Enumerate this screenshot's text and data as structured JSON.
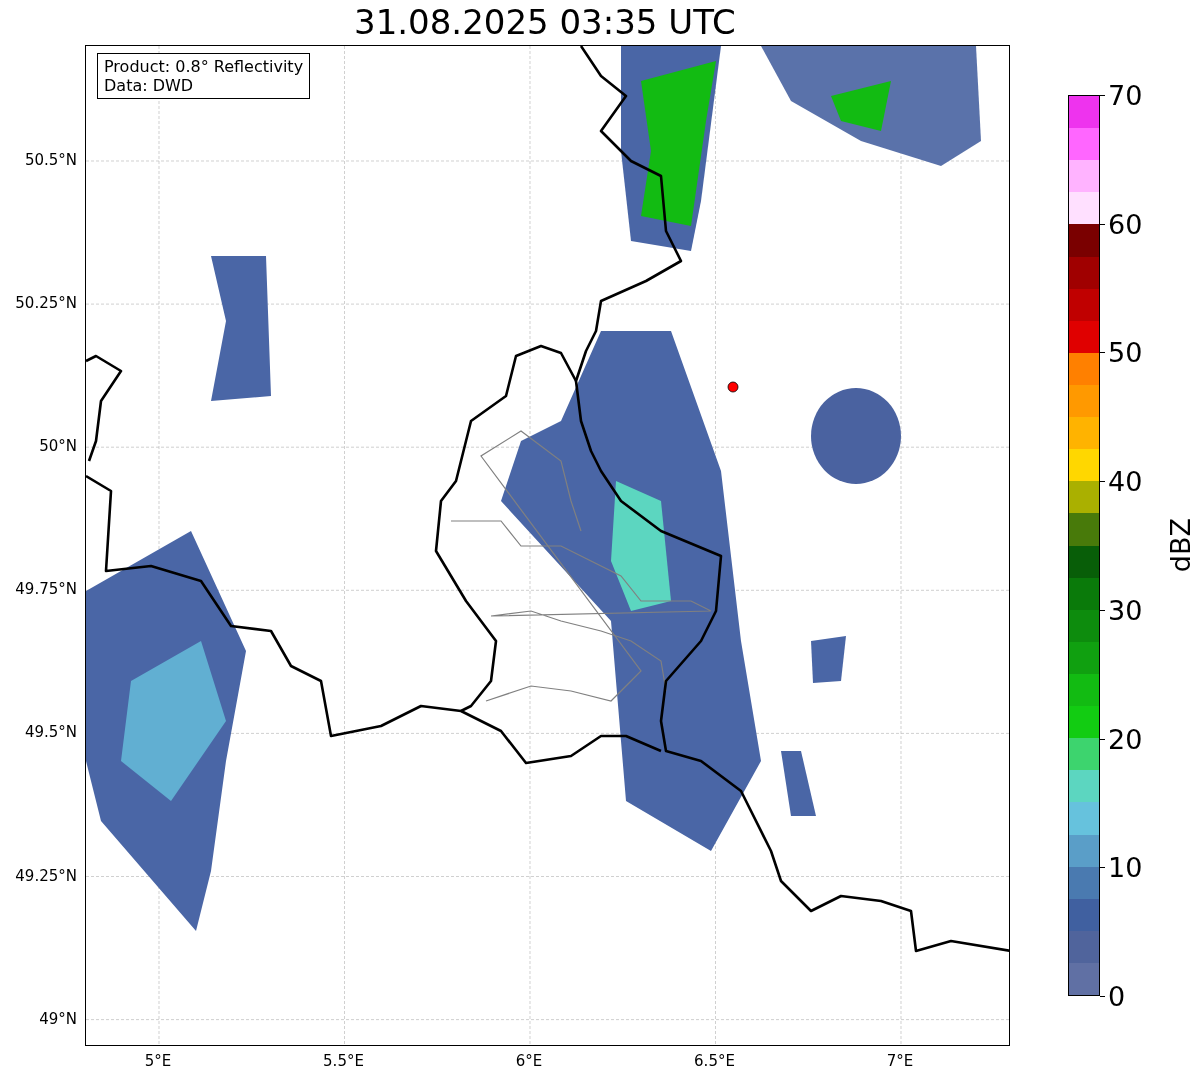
{
  "title": "31.08.2025 03:35 UTC",
  "info_box": {
    "lines": [
      "Product: 0.8° Reflectivity",
      "Data: DWD"
    ]
  },
  "map": {
    "y_ticks": [
      "50.5°N",
      "50.25°N",
      "50°N",
      "49.75°N",
      "49.5°N",
      "49.25°N",
      "49°N"
    ],
    "x_ticks": [
      "5°E",
      "5.5°E",
      "6°E",
      "6.5°E",
      "7°E"
    ]
  },
  "colorbar": {
    "label": "dBZ",
    "ticks": [
      "70",
      "60",
      "50",
      "40",
      "30",
      "20",
      "10",
      "0"
    ],
    "bins": [
      {
        "color": "#ee33ee"
      },
      {
        "color": "#ff66ff"
      },
      {
        "color": "#ffb3ff"
      },
      {
        "color": "#ffe0ff"
      },
      {
        "color": "#7a0000"
      },
      {
        "color": "#a00000"
      },
      {
        "color": "#c00000"
      },
      {
        "color": "#e00000"
      },
      {
        "color": "#ff8000"
      },
      {
        "color": "#ff9900"
      },
      {
        "color": "#ffb300"
      },
      {
        "color": "#ffd700"
      },
      {
        "color": "#aab000"
      },
      {
        "color": "#487a0a"
      },
      {
        "color": "#085e08"
      },
      {
        "color": "#0a7a0a"
      },
      {
        "color": "#0d8c0d"
      },
      {
        "color": "#10a010"
      },
      {
        "color": "#12bb12"
      },
      {
        "color": "#12cc12"
      },
      {
        "color": "#3dd46e"
      },
      {
        "color": "#5cd6c0"
      },
      {
        "color": "#66c2dd"
      },
      {
        "color": "#5a9ec8"
      },
      {
        "color": "#4a7ab0"
      },
      {
        "color": "#4060a0"
      },
      {
        "color": "#50649c"
      },
      {
        "color": "#6070a4"
      }
    ]
  }
}
